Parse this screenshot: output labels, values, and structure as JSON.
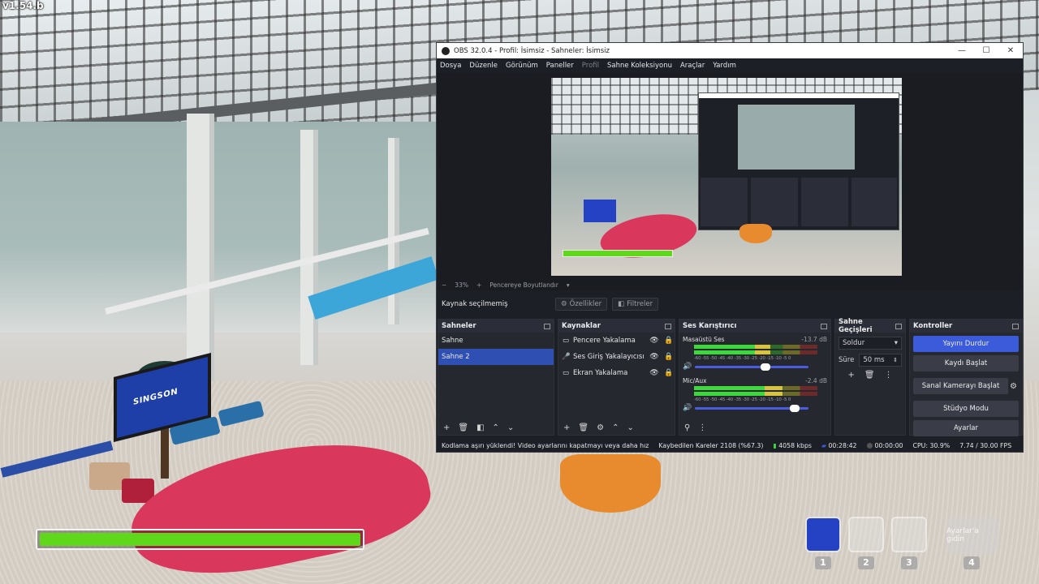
{
  "game": {
    "version": "v1.54.b",
    "tv_text": "SINGSON",
    "health": 1.0,
    "hotbar": [
      "1",
      "2",
      "3",
      "4"
    ],
    "hotbar_hint": "Ayarlar'a gidin"
  },
  "obs": {
    "title": "OBS 32.0.4 - Profil: İsimsiz - Sahneler: İsimsiz",
    "menu": [
      "Dosya",
      "Düzenle",
      "Görünüm",
      "Paneller",
      "Profil",
      "Sahne Koleksiyonu",
      "Araçlar",
      "Yardım"
    ],
    "zoom": {
      "minus": "−",
      "value": "33%",
      "plus": "+",
      "fit": "Pencereye Boyutlandır"
    },
    "source_bar": {
      "label": "Kaynak seçilmemiş",
      "properties": "Özellikler",
      "filters": "Filtreler"
    },
    "scenes": {
      "title": "Sahneler",
      "items": [
        "Sahne",
        "Sahne 2"
      ],
      "selected": "Sahne 2"
    },
    "sources": {
      "title": "Kaynaklar",
      "items": [
        {
          "label": "Pencere Yakalama",
          "icon": "window-icon"
        },
        {
          "label": "Ses Giriş Yakalayıcısı",
          "icon": "mic-icon"
        },
        {
          "label": "Ekran Yakalama",
          "icon": "monitor-icon"
        }
      ]
    },
    "mixer": {
      "title": "Ses Karıştırıcı",
      "ticks": "-60 -55 -50 -45 -40 -35 -30 -25 -20 -15 -10 -5 0",
      "channels": [
        {
          "name": "Masaüstü Ses",
          "db": "-13.7 dB",
          "level": 0.62,
          "volume": 0.62
        },
        {
          "name": "Mic/Aux",
          "db": "-2.4 dB",
          "level": 0.72,
          "volume": 0.88
        }
      ]
    },
    "transitions": {
      "title": "Sahne Geçişleri",
      "selected": "Soldur",
      "duration_label": "Süre",
      "duration": "50 ms"
    },
    "controls": {
      "title": "Kontroller",
      "buttons": [
        "Yayını Durdur",
        "Kaydı Başlat",
        "Sanal Kamerayı Başlat",
        "Stüdyo Modu",
        "Ayarlar"
      ]
    },
    "status": {
      "message": "Kodlama aşırı yüklendi! Video ayarlarını kapatmayı veya daha hız",
      "dropped": "Kaybedilen Kareler 2108 (%67.3)",
      "bitrate": "4058 kbps",
      "stream_time": "00:28:42",
      "record_time": "00:00:00",
      "cpu": "CPU: 30.9%",
      "fps": "7.74 / 30.00 FPS"
    }
  },
  "colors": {
    "accent": "#3b5bdb",
    "health": "#5fd81b",
    "obs_bg": "#1d1f26"
  }
}
